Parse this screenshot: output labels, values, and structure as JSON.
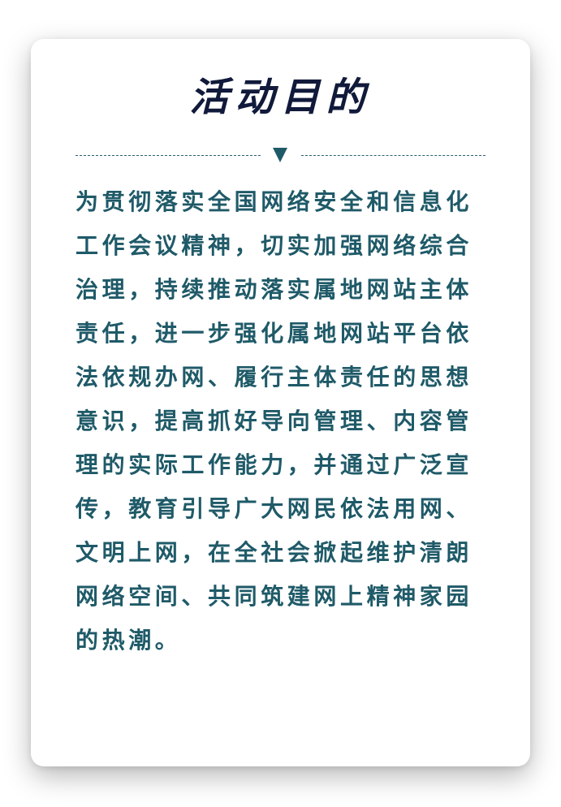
{
  "title": "活动目的",
  "body": "为贯彻落实全国网络安全和信息化工作会议精神，切实加强网络综合治理，持续推动落实属地网站主体责任，进一步强化属地网站平台依法依规办网、履行主体责任的思想意识，提高抓好导向管理、内容管理的实际工作能力，并通过广泛宣传，教育引导广大网民依法用网、文明上网，在全社会掀起维护清朗网络空间、共同筑建网上精神家园的热潮。",
  "colors": {
    "title": "#111a3a",
    "body_text": "#1f5a68",
    "divider": "#2a5f6d"
  },
  "icons": {
    "divider_marker": "triangle-down-icon"
  }
}
